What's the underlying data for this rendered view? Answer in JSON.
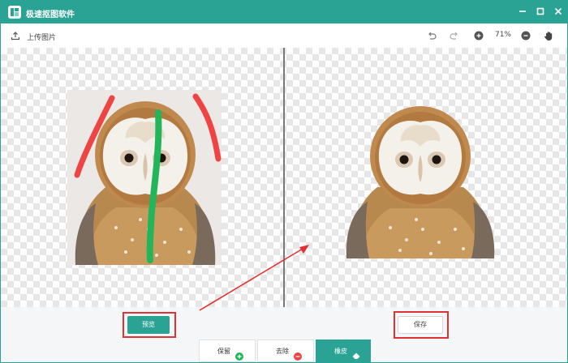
{
  "app": {
    "title": "极速抠图软件",
    "accent_color": "#2aa394",
    "logo_icon": "app-logo-icon"
  },
  "window_controls": {
    "minimize_icon": "minimize-icon",
    "maximize_icon": "maximize-icon",
    "close_icon": "close-icon"
  },
  "toolbar": {
    "upload_label": "上传图片",
    "upload_icon": "upload-icon",
    "undo_icon": "undo-icon",
    "redo_icon": "redo-icon",
    "zoom_in_icon": "zoom-in-icon",
    "zoom_level": "71%",
    "zoom_out_icon": "zoom-out-icon",
    "pan_icon": "hand-icon"
  },
  "canvas": {
    "left_image": "owl-original-with-strokes",
    "right_image": "owl-cutout-result",
    "keep_stroke_color": "#22b55a",
    "remove_stroke_color": "#ee4444",
    "annotation_color": "#e03232"
  },
  "actions": {
    "preview_label": "预览",
    "save_label": "保存"
  },
  "modes": [
    {
      "label": "保留",
      "icon": "plus-circle-icon",
      "color": "#22b55a",
      "active": false
    },
    {
      "label": "去除",
      "icon": "minus-circle-icon",
      "color": "#ee4444",
      "active": false
    },
    {
      "label": "橡皮",
      "icon": "eraser-icon",
      "color": "#ffffff",
      "active": true
    }
  ]
}
